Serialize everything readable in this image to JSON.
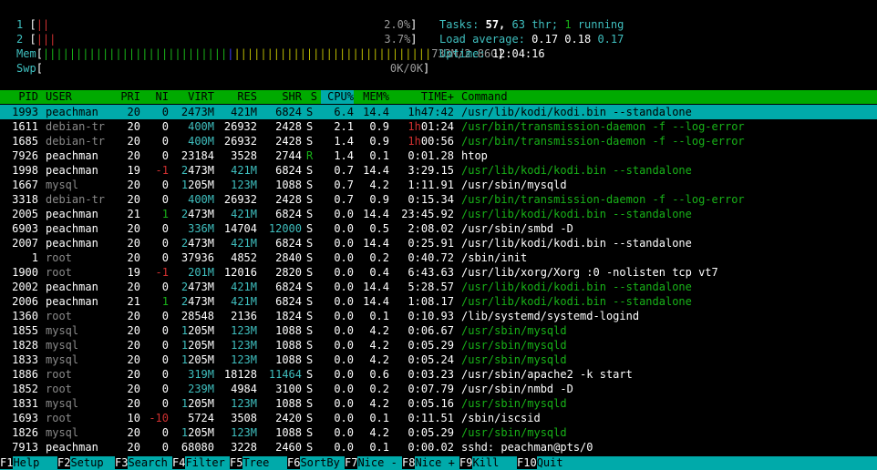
{
  "cpu": [
    {
      "label": "1",
      "value": "2.0%"
    },
    {
      "label": "2",
      "value": "3.7%"
    }
  ],
  "mem": {
    "label": "Mem",
    "value": "733M/2.86G"
  },
  "swp": {
    "label": "Swp",
    "value": "0K/0K"
  },
  "tasks": {
    "label": "Tasks:",
    "total": "57,",
    "thr": "63",
    "thr_label": "thr;",
    "running": "1",
    "running_label": "running"
  },
  "load": {
    "label": "Load average:",
    "l1": "0.17",
    "l5": "0.18",
    "l15": "0.17"
  },
  "uptime": {
    "label": "Uptime:",
    "value": "12:04:16"
  },
  "columns": [
    "PID",
    "USER",
    "PRI",
    "NI",
    "VIRT",
    "RES",
    "SHR",
    "S",
    "CPU%",
    "MEM%",
    "TIME+",
    "Command"
  ],
  "processes": [
    {
      "pid": "1993",
      "user": "peachman",
      "pri": "20",
      "ni": "0",
      "virt": "2473M",
      "res": "421M",
      "shr": "6824",
      "s": "S",
      "cpu": "6.4",
      "mem": "14.4",
      "time": "1h47:42",
      "cmd": "/usr/lib/kodi/kodi.bin --standalone",
      "selected": true
    },
    {
      "pid": "1611",
      "user": "debian-tr",
      "pri": "20",
      "ni": "0",
      "virt": "400M",
      "res": "26932",
      "shr": "2428",
      "s": "S",
      "cpu": "2.1",
      "mem": "0.9",
      "time": "1h01:24",
      "cmd": "/usr/bin/transmission-daemon -f --log-error"
    },
    {
      "pid": "1685",
      "user": "debian-tr",
      "pri": "20",
      "ni": "0",
      "virt": "400M",
      "res": "26932",
      "shr": "2428",
      "s": "S",
      "cpu": "1.4",
      "mem": "0.9",
      "time": "1h00:56",
      "cmd": "/usr/bin/transmission-daemon -f --log-error"
    },
    {
      "pid": "7926",
      "user": "peachman",
      "pri": "20",
      "ni": "0",
      "virt": "23184",
      "res": "3528",
      "shr": "2744",
      "s": "R",
      "cpu": "1.4",
      "mem": "0.1",
      "time": "0:01.28",
      "cmd": "htop"
    },
    {
      "pid": "1998",
      "user": "peachman",
      "pri": "19",
      "ni": "-1",
      "virt": "2473M",
      "res": "421M",
      "shr": "6824",
      "s": "S",
      "cpu": "0.7",
      "mem": "14.4",
      "time": "3:29.15",
      "cmd": "/usr/lib/kodi/kodi.bin --standalone"
    },
    {
      "pid": "1667",
      "user": "mysql",
      "pri": "20",
      "ni": "0",
      "virt": "1205M",
      "res": "123M",
      "shr": "1088",
      "s": "S",
      "cpu": "0.7",
      "mem": "4.2",
      "time": "1:11.91",
      "cmd": "/usr/sbin/mysqld"
    },
    {
      "pid": "3318",
      "user": "debian-tr",
      "pri": "20",
      "ni": "0",
      "virt": "400M",
      "res": "26932",
      "shr": "2428",
      "s": "S",
      "cpu": "0.7",
      "mem": "0.9",
      "time": "0:15.34",
      "cmd": "/usr/bin/transmission-daemon -f --log-error"
    },
    {
      "pid": "2005",
      "user": "peachman",
      "pri": "21",
      "ni": "1",
      "virt": "2473M",
      "res": "421M",
      "shr": "6824",
      "s": "S",
      "cpu": "0.0",
      "mem": "14.4",
      "time": "23:45.92",
      "cmd": "/usr/lib/kodi/kodi.bin --standalone"
    },
    {
      "pid": "6903",
      "user": "peachman",
      "pri": "20",
      "ni": "0",
      "virt": "336M",
      "res": "14704",
      "shr": "12000",
      "s": "S",
      "cpu": "0.0",
      "mem": "0.5",
      "time": "2:08.02",
      "cmd": "/usr/sbin/smbd -D"
    },
    {
      "pid": "2007",
      "user": "peachman",
      "pri": "20",
      "ni": "0",
      "virt": "2473M",
      "res": "421M",
      "shr": "6824",
      "s": "S",
      "cpu": "0.0",
      "mem": "14.4",
      "time": "0:25.91",
      "cmd": "/usr/lib/kodi/kodi.bin --standalone"
    },
    {
      "pid": "1",
      "user": "root",
      "pri": "20",
      "ni": "0",
      "virt": "37936",
      "res": "4852",
      "shr": "2840",
      "s": "S",
      "cpu": "0.0",
      "mem": "0.2",
      "time": "0:40.72",
      "cmd": "/sbin/init"
    },
    {
      "pid": "1900",
      "user": "root",
      "pri": "19",
      "ni": "-1",
      "virt": "201M",
      "res": "12016",
      "shr": "2820",
      "s": "S",
      "cpu": "0.0",
      "mem": "0.4",
      "time": "6:43.63",
      "cmd": "/usr/lib/xorg/Xorg :0 -nolisten tcp vt7"
    },
    {
      "pid": "2002",
      "user": "peachman",
      "pri": "20",
      "ni": "0",
      "virt": "2473M",
      "res": "421M",
      "shr": "6824",
      "s": "S",
      "cpu": "0.0",
      "mem": "14.4",
      "time": "5:28.57",
      "cmd": "/usr/lib/kodi/kodi.bin --standalone"
    },
    {
      "pid": "2006",
      "user": "peachman",
      "pri": "21",
      "ni": "1",
      "virt": "2473M",
      "res": "421M",
      "shr": "6824",
      "s": "S",
      "cpu": "0.0",
      "mem": "14.4",
      "time": "1:08.17",
      "cmd": "/usr/lib/kodi/kodi.bin --standalone"
    },
    {
      "pid": "1360",
      "user": "root",
      "pri": "20",
      "ni": "0",
      "virt": "28548",
      "res": "2136",
      "shr": "1824",
      "s": "S",
      "cpu": "0.0",
      "mem": "0.1",
      "time": "0:10.93",
      "cmd": "/lib/systemd/systemd-logind"
    },
    {
      "pid": "1855",
      "user": "mysql",
      "pri": "20",
      "ni": "0",
      "virt": "1205M",
      "res": "123M",
      "shr": "1088",
      "s": "S",
      "cpu": "0.0",
      "mem": "4.2",
      "time": "0:06.67",
      "cmd": "/usr/sbin/mysqld"
    },
    {
      "pid": "1828",
      "user": "mysql",
      "pri": "20",
      "ni": "0",
      "virt": "1205M",
      "res": "123M",
      "shr": "1088",
      "s": "S",
      "cpu": "0.0",
      "mem": "4.2",
      "time": "0:05.29",
      "cmd": "/usr/sbin/mysqld"
    },
    {
      "pid": "1833",
      "user": "mysql",
      "pri": "20",
      "ni": "0",
      "virt": "1205M",
      "res": "123M",
      "shr": "1088",
      "s": "S",
      "cpu": "0.0",
      "mem": "4.2",
      "time": "0:05.24",
      "cmd": "/usr/sbin/mysqld"
    },
    {
      "pid": "1886",
      "user": "root",
      "pri": "20",
      "ni": "0",
      "virt": "319M",
      "res": "18128",
      "shr": "11464",
      "s": "S",
      "cpu": "0.0",
      "mem": "0.6",
      "time": "0:03.23",
      "cmd": "/usr/sbin/apache2 -k start"
    },
    {
      "pid": "1852",
      "user": "root",
      "pri": "20",
      "ni": "0",
      "virt": "239M",
      "res": "4984",
      "shr": "3100",
      "s": "S",
      "cpu": "0.0",
      "mem": "0.2",
      "time": "0:07.79",
      "cmd": "/usr/sbin/nmbd -D"
    },
    {
      "pid": "1831",
      "user": "mysql",
      "pri": "20",
      "ni": "0",
      "virt": "1205M",
      "res": "123M",
      "shr": "1088",
      "s": "S",
      "cpu": "0.0",
      "mem": "4.2",
      "time": "0:05.16",
      "cmd": "/usr/sbin/mysqld"
    },
    {
      "pid": "1693",
      "user": "root",
      "pri": "10",
      "ni": "-10",
      "virt": "5724",
      "res": "3508",
      "shr": "2420",
      "s": "S",
      "cpu": "0.0",
      "mem": "0.1",
      "time": "0:11.51",
      "cmd": "/sbin/iscsid"
    },
    {
      "pid": "1826",
      "user": "mysql",
      "pri": "20",
      "ni": "0",
      "virt": "1205M",
      "res": "123M",
      "shr": "1088",
      "s": "S",
      "cpu": "0.0",
      "mem": "4.2",
      "time": "0:05.29",
      "cmd": "/usr/sbin/mysqld"
    },
    {
      "pid": "7913",
      "user": "peachman",
      "pri": "20",
      "ni": "0",
      "virt": "68080",
      "res": "3228",
      "shr": "2460",
      "s": "S",
      "cpu": "0.0",
      "mem": "0.1",
      "time": "0:00.02",
      "cmd": "sshd: peachman@pts/0"
    }
  ],
  "footer": [
    {
      "key": "F1",
      "label": "Help"
    },
    {
      "key": "F2",
      "label": "Setup"
    },
    {
      "key": "F3",
      "label": "Search"
    },
    {
      "key": "F4",
      "label": "Filter"
    },
    {
      "key": "F5",
      "label": "Tree"
    },
    {
      "key": "F6",
      "label": "SortBy"
    },
    {
      "key": "F7",
      "label": "Nice -"
    },
    {
      "key": "F8",
      "label": "Nice +"
    },
    {
      "key": "F9",
      "label": "Kill"
    },
    {
      "key": "F10",
      "label": "Quit"
    }
  ]
}
